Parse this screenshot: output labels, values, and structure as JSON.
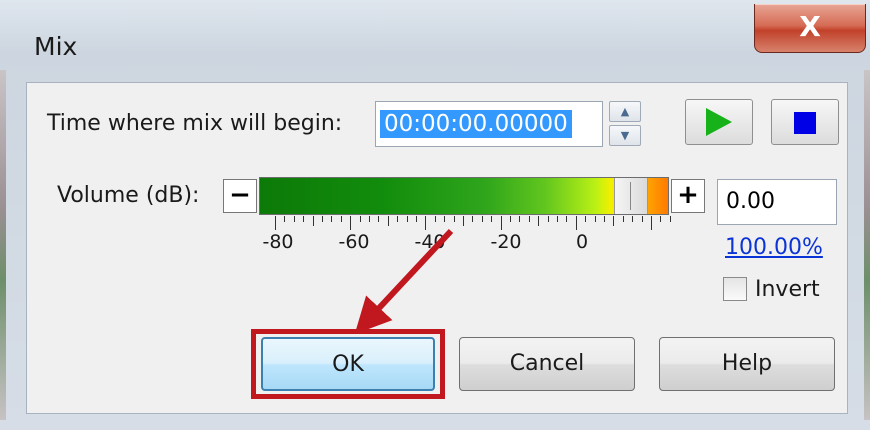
{
  "window": {
    "title": "Mix",
    "close_glyph": "X"
  },
  "time_row": {
    "label": "Time where mix will begin:",
    "value": "00:00:00.00000",
    "spin_up_glyph": "▲",
    "spin_down_glyph": "▼"
  },
  "transport": {
    "play_icon": "play-icon",
    "stop_icon": "stop-icon"
  },
  "volume": {
    "label": "Volume (dB):",
    "minus_glyph": "−",
    "plus_glyph": "+",
    "db_value": "0.00",
    "percent_link": "100.00%",
    "scale_labels": [
      "-80",
      "-60",
      "-40",
      "-20",
      "0"
    ]
  },
  "invert": {
    "label": "Invert",
    "checked": false
  },
  "buttons": {
    "ok": "OK",
    "cancel": "Cancel",
    "help": "Help"
  },
  "colors": {
    "highlight": "#c0181e",
    "play": "#17b21a",
    "stop": "#0000e6",
    "link": "#0b34d6",
    "selection": "#3399ff"
  }
}
